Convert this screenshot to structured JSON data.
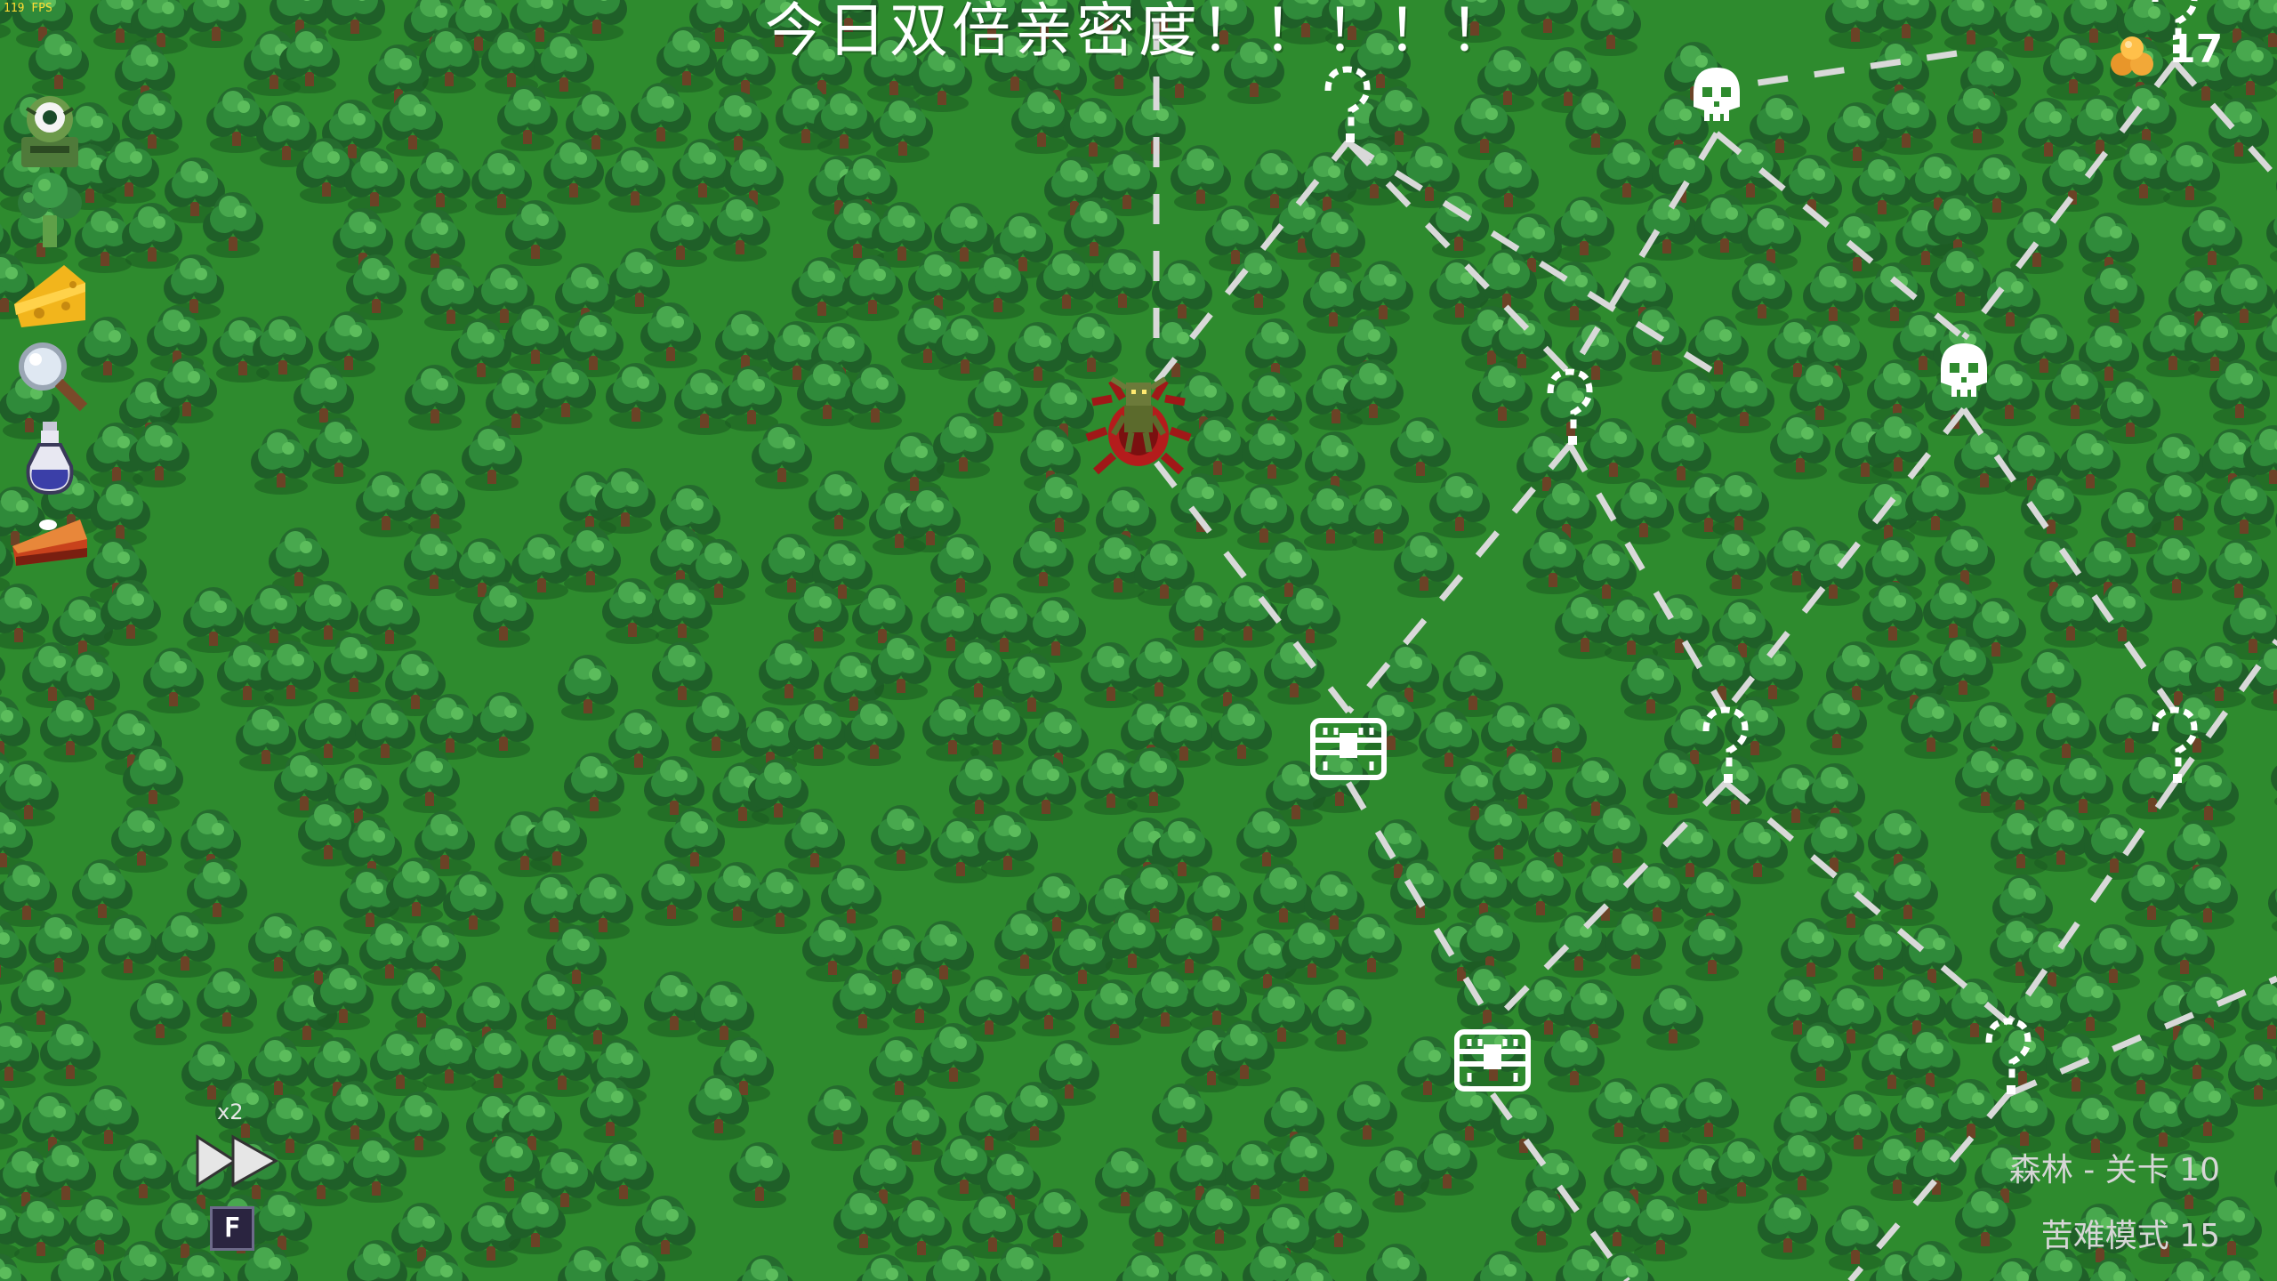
{
  "hud": {
    "fps": "119 FPS",
    "banner": "今日双倍亲密度！！！！！",
    "gold_count": "17",
    "speed_multiplier": "x2",
    "speed_hotkey": "F",
    "area_info": "森林 - 关卡 10",
    "mode_info": "苦难模式 15"
  },
  "relics": [
    {
      "name": "eye-monster-icon"
    },
    {
      "name": "broccoli-icon"
    },
    {
      "name": "cheese-icon"
    },
    {
      "name": "magnifying-glass-icon"
    },
    {
      "name": "potion-icon"
    },
    {
      "name": "pie-icon"
    }
  ],
  "map_nodes": [
    {
      "type": "question",
      "name": "unknown-event-icon"
    },
    {
      "type": "skull",
      "name": "enemy-skull-icon"
    },
    {
      "type": "question",
      "name": "unknown-event-icon"
    },
    {
      "type": "skull",
      "name": "enemy-skull-icon"
    },
    {
      "type": "chest",
      "name": "treasure-chest-icon"
    },
    {
      "type": "question",
      "name": "unknown-event-icon"
    },
    {
      "type": "question",
      "name": "unknown-event-icon"
    },
    {
      "type": "chest",
      "name": "treasure-chest-icon"
    },
    {
      "type": "question",
      "name": "unknown-event-icon"
    },
    {
      "type": "question",
      "name": "unknown-event-icon"
    }
  ],
  "player": {
    "name": "goblin-player-icon"
  },
  "colors": {
    "grass": "#2e8b2e",
    "tree_dark": "#1f5f28",
    "tree_mid": "#2f8a3a",
    "tree_light": "#48a84e",
    "path": "#d9d9d9",
    "player_aura": "#a01818"
  }
}
